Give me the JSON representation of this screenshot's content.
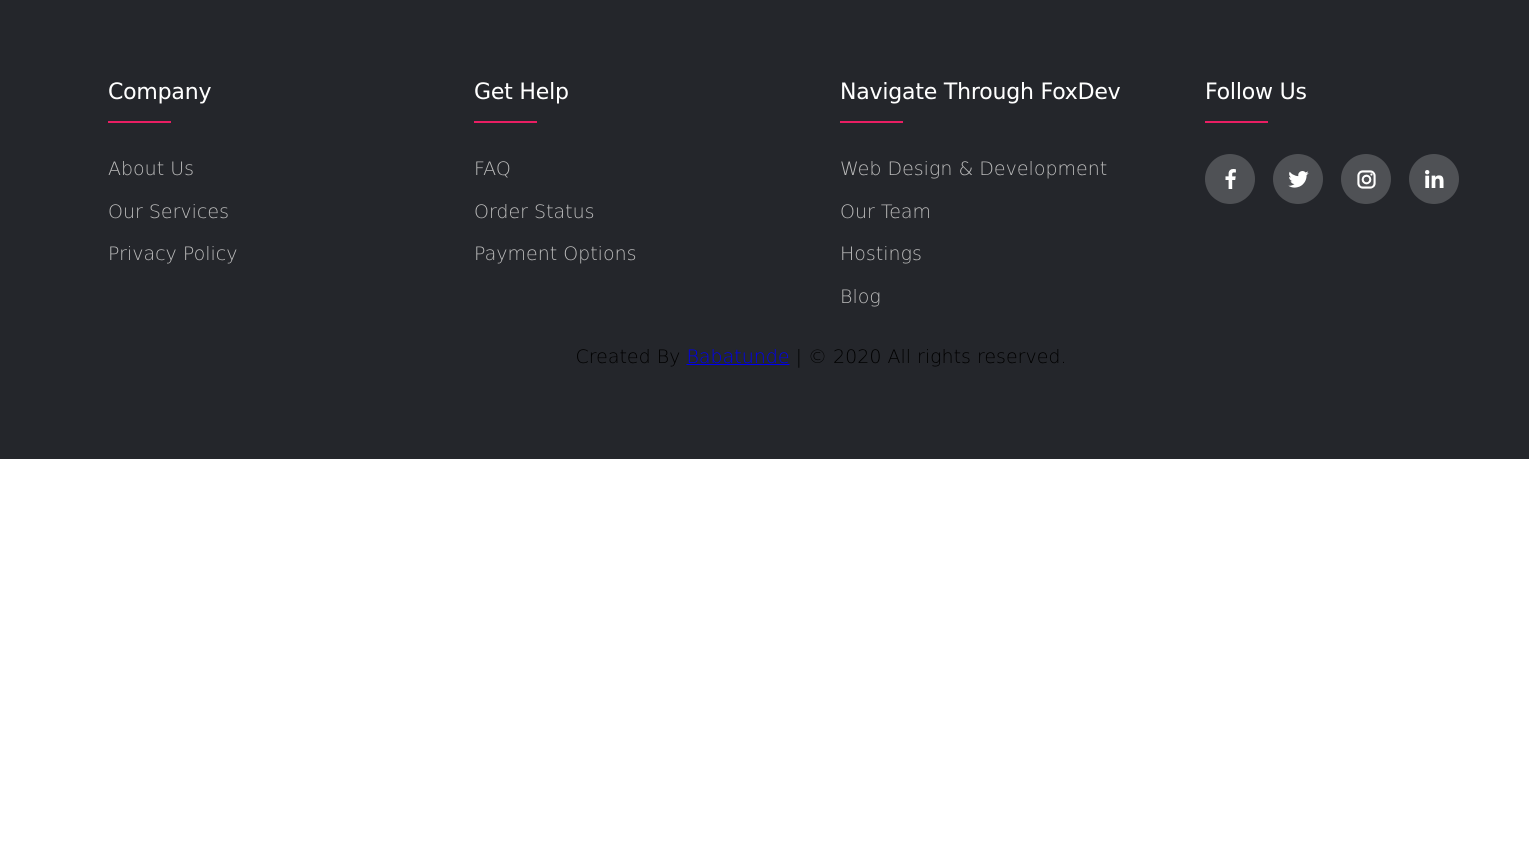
{
  "footer": {
    "background_color": "#24262b",
    "accent_color": "#e91e63",
    "columns": [
      {
        "title": "Company",
        "links": [
          "About Us",
          "Our Services",
          "Privacy Policy"
        ]
      },
      {
        "title": "Get Help",
        "links": [
          "FAQ",
          "Order Status",
          "Payment Options"
        ]
      },
      {
        "title": "Navigate Through FoxDev",
        "links": [
          "Web Design & Development",
          "Our Team",
          "Hostings",
          "Blog"
        ]
      },
      {
        "title": "Follow Us",
        "social": [
          "facebook-icon",
          "twitter-icon",
          "instagram-icon",
          "linkedin-icon"
        ]
      }
    ],
    "copyright": {
      "prefix": "Created By",
      "author": "Babatunde",
      "suffix": "| © 2020 All rights reserved."
    }
  }
}
